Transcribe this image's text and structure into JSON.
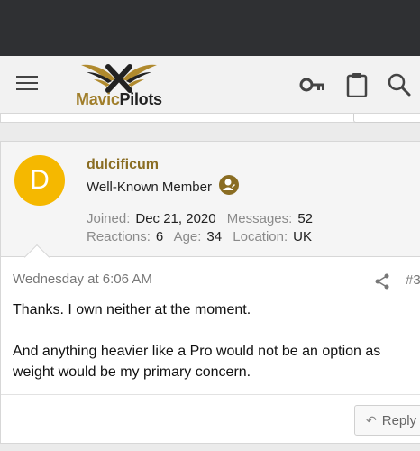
{
  "header": {
    "logo_part1": "Mavic",
    "logo_part2": "Pilots"
  },
  "icons": {
    "menu": "menu-icon",
    "key": "key-icon",
    "clipboard": "clipboard-icon",
    "search": "search-icon",
    "share": "share-icon",
    "reply": "reply-icon"
  },
  "colors": {
    "brand_gold": "#8a6d23",
    "avatar_bg": "#f5b800",
    "status_bar": "#2f3033"
  },
  "post": {
    "avatar_letter": "D",
    "username": "dulcificum",
    "user_title": "Well-Known Member",
    "stats": {
      "joined_label": "Joined:",
      "joined_value": "Dec 21, 2020",
      "messages_label": "Messages:",
      "messages_value": "52",
      "reactions_label": "Reactions:",
      "reactions_value": "6",
      "age_label": "Age:",
      "age_value": "34",
      "location_label": "Location:",
      "location_value": "UK"
    },
    "date": "Wednesday at 6:06 AM",
    "number": "#3",
    "body": [
      "Thanks. I own neither at the moment.",
      "And anything heavier like a Pro would not be an option as weight would be my primary concern."
    ],
    "reply_label": "Reply"
  }
}
